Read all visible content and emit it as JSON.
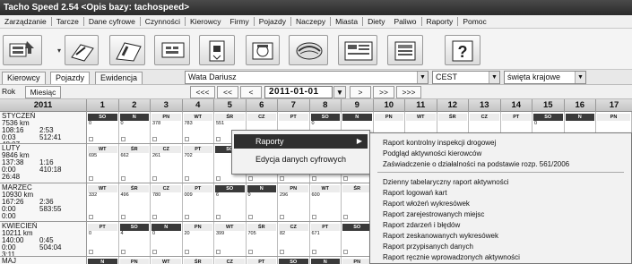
{
  "window": {
    "title": "Tacho Speed 2.54 <Opis bazy: tachospeed>"
  },
  "menubar": [
    "Zarządzanie",
    "Tarcze",
    "Dane cyfrowe",
    "Czynności",
    "Kierowcy",
    "Firmy",
    "Pojazdy",
    "Naczepy",
    "Miasta",
    "Diety",
    "Paliwo",
    "Raporty",
    "Pomoc"
  ],
  "tabs": [
    "Kierowcy",
    "Pojazdy",
    "Ewidencja"
  ],
  "driver": {
    "name": "Wata Dariusz"
  },
  "timezone": {
    "value": "CEST"
  },
  "holidays": {
    "value": "święta krajowe"
  },
  "nav": {
    "rok": "Rok",
    "miesiac": "Miesiąc",
    "first": "<<<",
    "prev_big": "<<",
    "prev": "<",
    "date": "2011-01-01",
    "next": ">",
    "next_big": ">>",
    "last": ">>>"
  },
  "grid": {
    "year": "2011",
    "days": [
      "1",
      "2",
      "3",
      "4",
      "5",
      "6",
      "7",
      "8",
      "9",
      "10",
      "11",
      "12",
      "13",
      "14",
      "15",
      "16",
      "17"
    ],
    "months": [
      {
        "name": "STYCZEŃ",
        "km": "7536 km",
        "l1a": "108:16",
        "l1b": "2:53",
        "l2a": "0:03",
        "l2b": "512:41",
        "l3a": "48:07",
        "l3b": "",
        "dh": [
          "SO",
          "N",
          "PN",
          "WT",
          "ŚR",
          "CZ",
          "PT",
          "SO",
          "N",
          "PN",
          "WT",
          "ŚR",
          "CZ",
          "PT",
          "SO",
          "N",
          "PN"
        ],
        "dv": [
          "0",
          "0",
          "378",
          "783",
          "551",
          "",
          "",
          "0",
          "",
          "",
          "",
          "",
          "",
          "",
          "0",
          "",
          ""
        ]
      },
      {
        "name": "LUTY",
        "km": "9846 km",
        "l1a": "137:38",
        "l1b": "1:16",
        "l2a": "0:00",
        "l2b": "410:18",
        "l3a": "26:48",
        "l3b": "",
        "dh": [
          "WT",
          "ŚR",
          "CZ",
          "PT",
          "SO",
          "N",
          "PN",
          "WT",
          "ŚR",
          "CZ",
          "PT",
          "SO",
          "N",
          "PN",
          "WT",
          "ŚR",
          "CZ"
        ],
        "dv": [
          "695",
          "662",
          "261",
          "702",
          "",
          "",
          "",
          "",
          "",
          "",
          "",
          "",
          "",
          "",
          "",
          "",
          ""
        ]
      },
      {
        "name": "MARZEC",
        "km": "10930 km",
        "l1a": "167:26",
        "l1b": "2:36",
        "l2a": "0:00",
        "l2b": "583:55",
        "l3a": "0:00",
        "l3b": "",
        "dh": [
          "WT",
          "ŚR",
          "CZ",
          "PT",
          "SO",
          "N",
          "PN",
          "WT",
          "ŚR",
          "CZ",
          "PT",
          "SO",
          "N",
          "PN",
          "WT",
          "ŚR",
          "CZ"
        ],
        "dv": [
          "332",
          "496",
          "780",
          "009",
          "6",
          "0",
          "296",
          "600",
          "",
          "",
          "",
          "",
          "",
          "",
          "",
          "",
          ""
        ]
      },
      {
        "name": "KWIECIEŃ",
        "km": "10211 km",
        "l1a": "140:00",
        "l1b": "0:45",
        "l2a": "0:00",
        "l2b": "504:04",
        "l3a": "3:11",
        "l3b": "",
        "dh": [
          "PT",
          "SO",
          "N",
          "PN",
          "WT",
          "ŚR",
          "CZ",
          "PT",
          "SO",
          "N",
          "PN",
          "WT",
          "ŚR",
          "CZ",
          "PT",
          "SO",
          "N"
        ],
        "dv": [
          "0",
          "4",
          "0",
          "20",
          "399",
          "705",
          "82",
          "671",
          "",
          "",
          "",
          "",
          "",
          "",
          "",
          "",
          ""
        ]
      },
      {
        "name": "MAJ",
        "km": "8656 km",
        "l1a": "",
        "l1b": "",
        "l2a": "",
        "l2b": "",
        "l3a": "",
        "l3b": "",
        "dh": [
          "N",
          "PN",
          "WT",
          "ŚR",
          "CZ",
          "PT",
          "SO",
          "N",
          "PN",
          "WT",
          "ŚR",
          "CZ",
          "PT",
          "SO",
          "N",
          "PN",
          "WT"
        ],
        "dv": [
          "",
          "",
          "",
          "",
          "",
          "",
          "",
          "",
          "",
          "",
          "",
          "",
          "",
          "",
          "",
          "",
          ""
        ]
      }
    ]
  },
  "context_menu": {
    "items": [
      "Raporty",
      "Edycja danych cyfrowych"
    ],
    "submenu": [
      "Raport kontrolny inspekcji drogowej",
      "Podgląd aktywności kierowców",
      "Zaświadczenie o działalności na podstawie rozp. 561/2006",
      "Dzienny tabelaryczny raport aktywności",
      "Raport logowań kart",
      "Raport włożeń wykresówek",
      "Raport zarejestrowanych miejsc",
      "Raport zdarzeń i błędów",
      "Raport zeskanowanych wykresówek",
      "Raport przypisanych danych",
      "Raport ręcznie wprowadzonych aktywności"
    ]
  },
  "icons": [
    "add-driver-icon",
    "scan-chart-icon",
    "read-card-icon",
    "driver-card-icon",
    "download-icon",
    "tachograph-disc-icon",
    "reports-icon",
    "settings-table-icon",
    "help-icon"
  ]
}
